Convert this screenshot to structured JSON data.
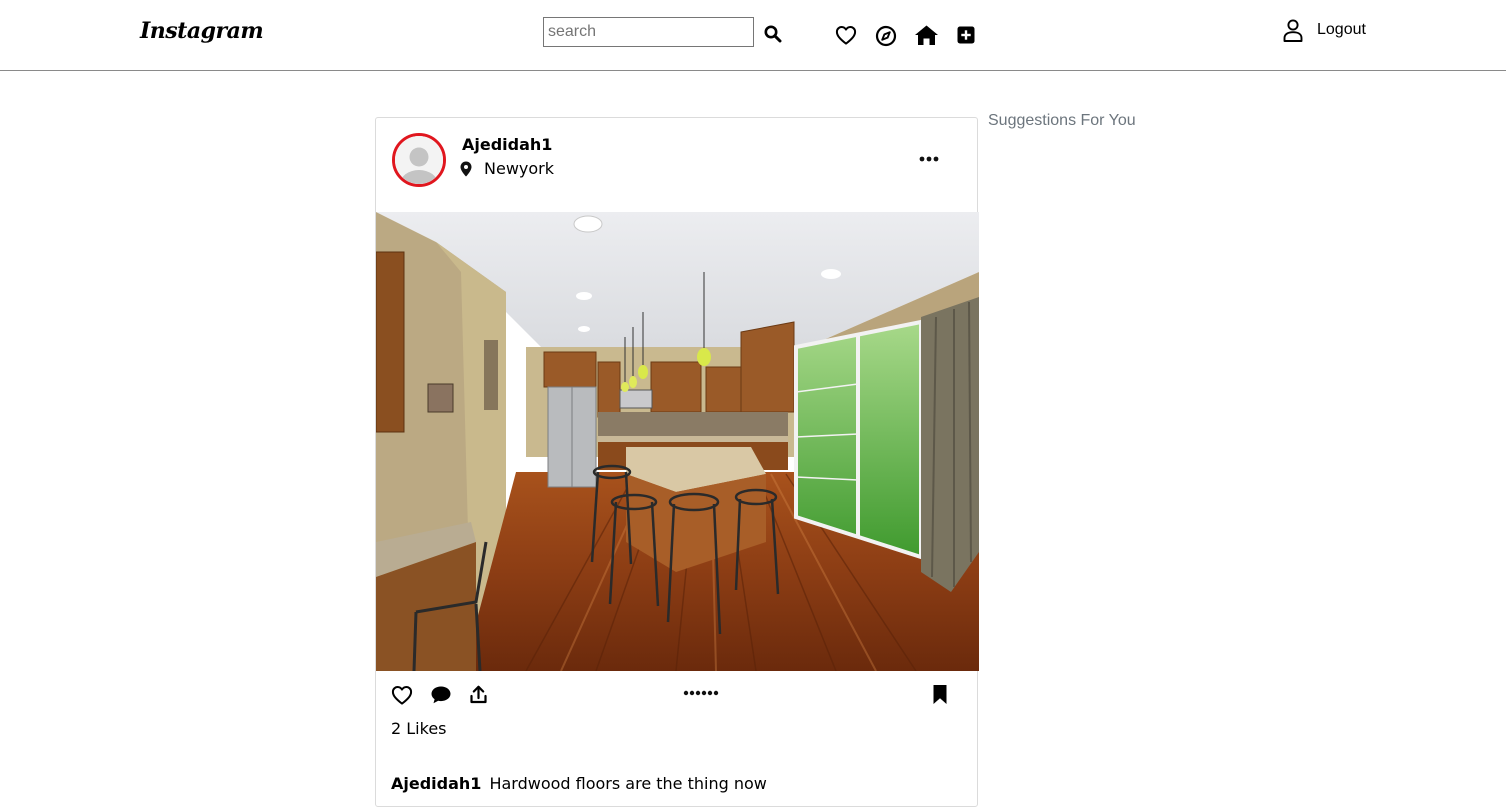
{
  "navbar": {
    "logo": "Instagram",
    "search": {
      "placeholder": "search",
      "value": ""
    },
    "icons": [
      "search-icon",
      "heart-icon",
      "compass-icon",
      "home-icon",
      "plus-square-icon",
      "user-icon"
    ],
    "logout_label": "Logout"
  },
  "post": {
    "username": "Ajedidah1",
    "location": "Newyork",
    "likes": "2 Likes",
    "caption_user": "Ajedidah1",
    "caption_text": "Hardwood floors are the thing now",
    "image_subject": "kitchen interior with hardwood floors",
    "story_ring_color": "#e0161e"
  },
  "sidebar": {
    "suggestions_title": "Suggestions For You"
  }
}
